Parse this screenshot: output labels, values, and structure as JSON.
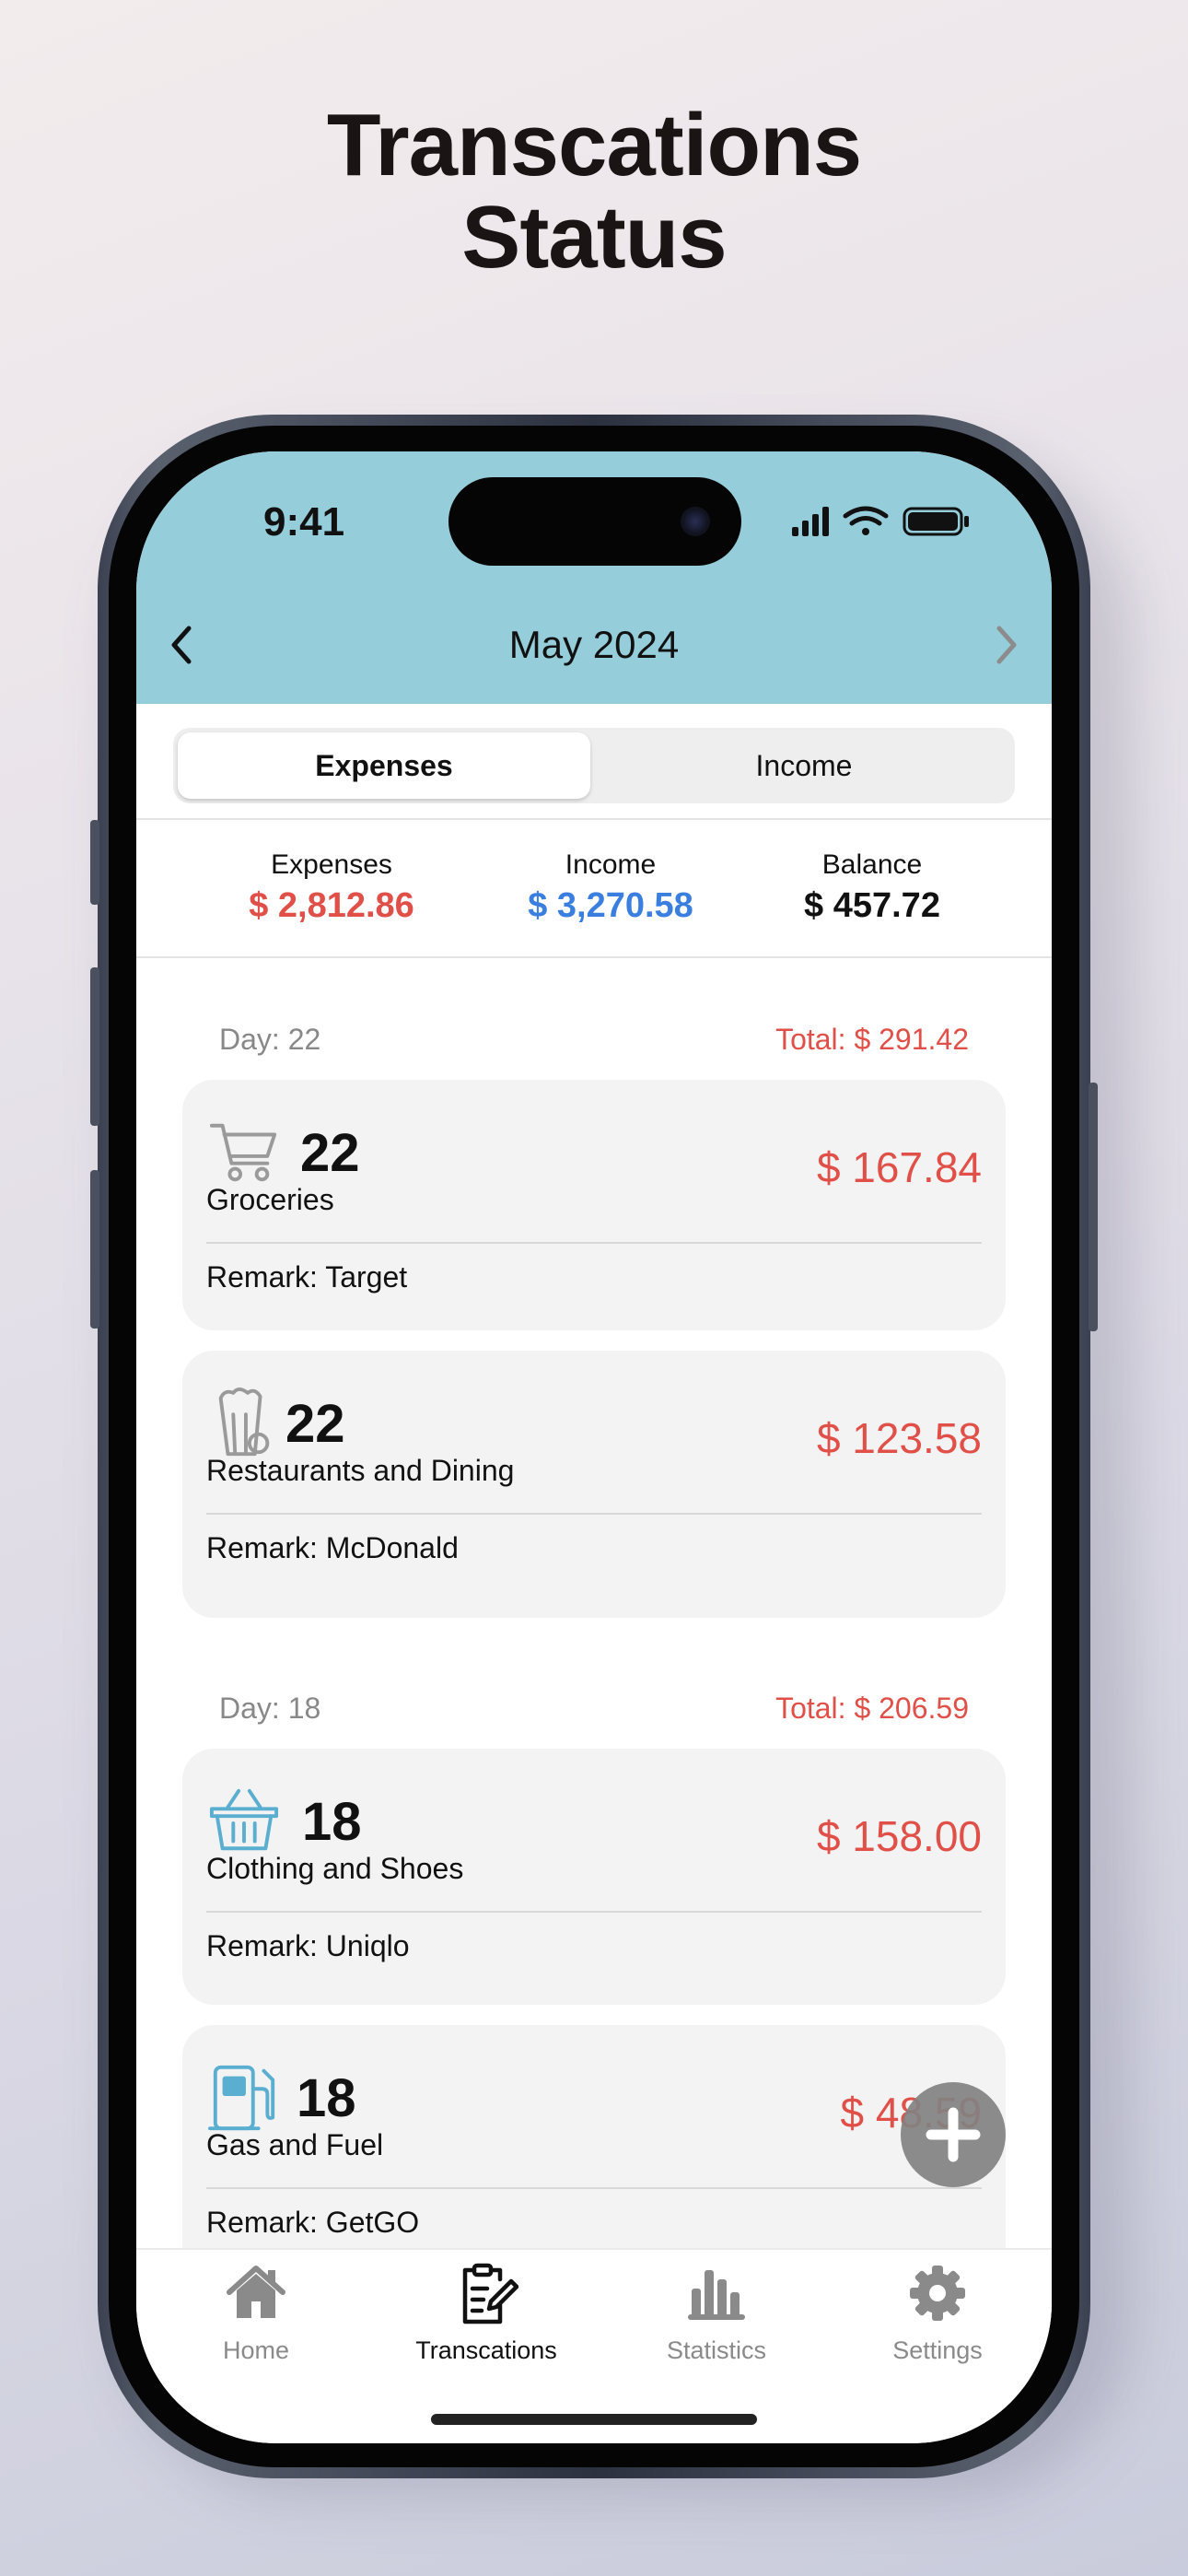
{
  "headline": {
    "line1": "Transcations",
    "line2": "Status"
  },
  "status_bar": {
    "time": "9:41",
    "icons": [
      "signal-icon",
      "wifi-icon",
      "battery-icon"
    ]
  },
  "nav": {
    "title": "May 2024",
    "prev_icon": "chevron-left-icon",
    "next_icon": "chevron-right-icon"
  },
  "segmented": {
    "options": [
      "Expenses",
      "Income"
    ],
    "selected": "Expenses"
  },
  "summary": {
    "expenses_label": "Expenses",
    "expenses_value": "$ 2,812.86",
    "income_label": "Income",
    "income_value": "$ 3,270.58",
    "balance_label": "Balance",
    "balance_value": "$ 457.72"
  },
  "groups": [
    {
      "day_label": "Day: 22",
      "total_label": "Total: $ 291.42",
      "items": [
        {
          "icon": "shopping-cart-icon",
          "day": "22",
          "category": "Groceries",
          "amount": "$ 167.84",
          "remark": "Remark: Target"
        },
        {
          "icon": "popcorn-icon",
          "day": "22",
          "category": "Restaurants and Dining",
          "amount": "$ 123.58",
          "remark": "Remark: McDonald"
        }
      ]
    },
    {
      "day_label": "Day: 18",
      "total_label": "Total: $ 206.59",
      "items": [
        {
          "icon": "basket-icon",
          "day": "18",
          "category": "Clothing and Shoes",
          "amount": "$ 158.00",
          "remark": "Remark: Uniqlo"
        },
        {
          "icon": "gas-pump-icon",
          "day": "18",
          "category": "Gas and Fuel",
          "amount": "$ 48.59",
          "remark": "Remark: GetGO"
        }
      ]
    }
  ],
  "fab": {
    "icon": "plus-icon"
  },
  "tabs": [
    {
      "label": "Home",
      "icon": "house-icon",
      "active": false
    },
    {
      "label": "Transcations",
      "icon": "clipboard-edit-icon",
      "active": true
    },
    {
      "label": "Statistics",
      "icon": "bar-chart-icon",
      "active": false
    },
    {
      "label": "Settings",
      "icon": "gear-icon",
      "active": false
    }
  ],
  "colors": {
    "header_bg": "#95cddb",
    "expense_red": "#e05048",
    "income_blue": "#3a7fe0",
    "icon_gray": "#9a9a9a",
    "icon_teal": "#5aaed0"
  }
}
